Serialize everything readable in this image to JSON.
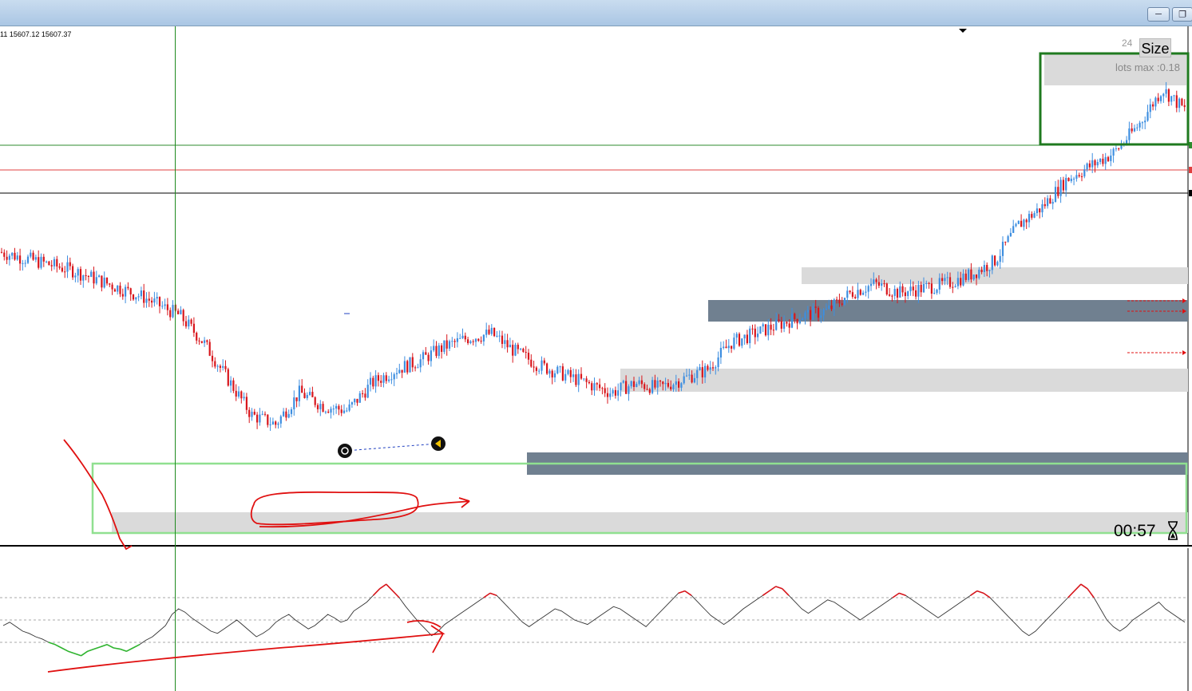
{
  "window": {
    "minimize_icon": "minimize-icon",
    "restore_icon": "restore-icon"
  },
  "chart": {
    "ohlc_text": "11 15607.12 15607.37",
    "timeframe_badge": "24",
    "size_button_label": "Size",
    "lots_label": "lots max :0.18",
    "candle_timer": "00:57",
    "colors": {
      "bull": "#3d8ee0",
      "bear": "#d8161c",
      "demand_zone_light": "#dadada",
      "demand_zone_dark": "#708090",
      "zone_outline_green": "#90e090",
      "range_box_green": "#1f7a1f",
      "level_line_green": "#2e8b2e",
      "level_line_red": "#e04040"
    }
  },
  "chart_data": {
    "type": "candlestick",
    "title": "",
    "xlabel": "",
    "ylabel": "",
    "ylim": [
      0,
      100
    ],
    "close_path": [
      [
        0,
        62
      ],
      [
        3,
        60
      ],
      [
        6,
        58
      ],
      [
        9,
        55
      ],
      [
        12,
        52
      ],
      [
        15,
        48
      ],
      [
        17,
        42
      ],
      [
        19,
        34
      ],
      [
        21,
        26
      ],
      [
        23,
        24
      ],
      [
        25,
        31
      ],
      [
        27,
        28
      ],
      [
        29,
        27
      ],
      [
        31,
        33
      ],
      [
        33,
        36
      ],
      [
        35,
        38
      ],
      [
        37,
        41
      ],
      [
        39,
        43
      ],
      [
        41,
        44
      ],
      [
        43,
        40
      ],
      [
        45,
        37
      ],
      [
        47,
        35
      ],
      [
        49,
        33
      ],
      [
        51,
        31
      ],
      [
        53,
        33
      ],
      [
        55,
        32
      ],
      [
        57,
        34
      ],
      [
        59,
        36
      ],
      [
        61,
        42
      ],
      [
        63,
        44
      ],
      [
        65,
        46
      ],
      [
        67,
        48
      ],
      [
        69,
        49
      ],
      [
        71,
        53
      ],
      [
        73,
        55
      ],
      [
        75,
        53
      ],
      [
        77,
        54
      ],
      [
        79,
        55
      ],
      [
        81,
        57
      ],
      [
        83,
        60
      ],
      [
        85,
        68
      ],
      [
        87,
        72
      ],
      [
        89,
        78
      ],
      [
        91,
        81
      ],
      [
        93,
        84
      ],
      [
        95,
        90
      ],
      [
        97,
        98
      ],
      [
        99,
        93
      ]
    ],
    "indicator": {
      "type": "line",
      "levels": [
        30,
        50,
        70
      ],
      "ylim": [
        0,
        100
      ],
      "values": [
        45,
        48,
        44,
        40,
        38,
        35,
        33,
        30,
        28,
        25,
        22,
        20,
        18,
        22,
        24,
        26,
        28,
        25,
        24,
        22,
        25,
        28,
        32,
        35,
        40,
        45,
        55,
        60,
        57,
        52,
        48,
        44,
        40,
        38,
        42,
        46,
        50,
        45,
        40,
        35,
        38,
        42,
        48,
        52,
        55,
        50,
        46,
        42,
        45,
        50,
        55,
        52,
        48,
        50,
        58,
        62,
        66,
        72,
        78,
        82,
        76,
        70,
        62,
        55,
        48,
        42,
        36,
        40,
        46,
        50,
        54,
        58,
        62,
        66,
        70,
        74,
        72,
        66,
        60,
        54,
        48,
        44,
        48,
        52,
        56,
        60,
        58,
        54,
        50,
        48,
        46,
        50,
        54,
        58,
        62,
        60,
        56,
        52,
        48,
        44,
        50,
        56,
        62,
        68,
        74,
        76,
        72,
        66,
        60,
        54,
        50,
        46,
        50,
        55,
        60,
        64,
        68,
        72,
        76,
        80,
        78,
        72,
        66,
        60,
        56,
        60,
        64,
        68,
        66,
        62,
        58,
        54,
        50,
        54,
        58,
        62,
        66,
        70,
        74,
        72,
        68,
        64,
        60,
        56,
        52,
        56,
        60,
        64,
        68,
        72,
        76,
        74,
        70,
        64,
        58,
        52,
        46,
        40,
        36,
        40,
        46,
        52,
        58,
        64,
        70,
        76,
        82,
        78,
        70,
        60,
        50,
        44,
        40,
        44,
        50,
        54,
        58,
        62,
        66,
        60,
        56,
        52,
        48
      ]
    }
  }
}
